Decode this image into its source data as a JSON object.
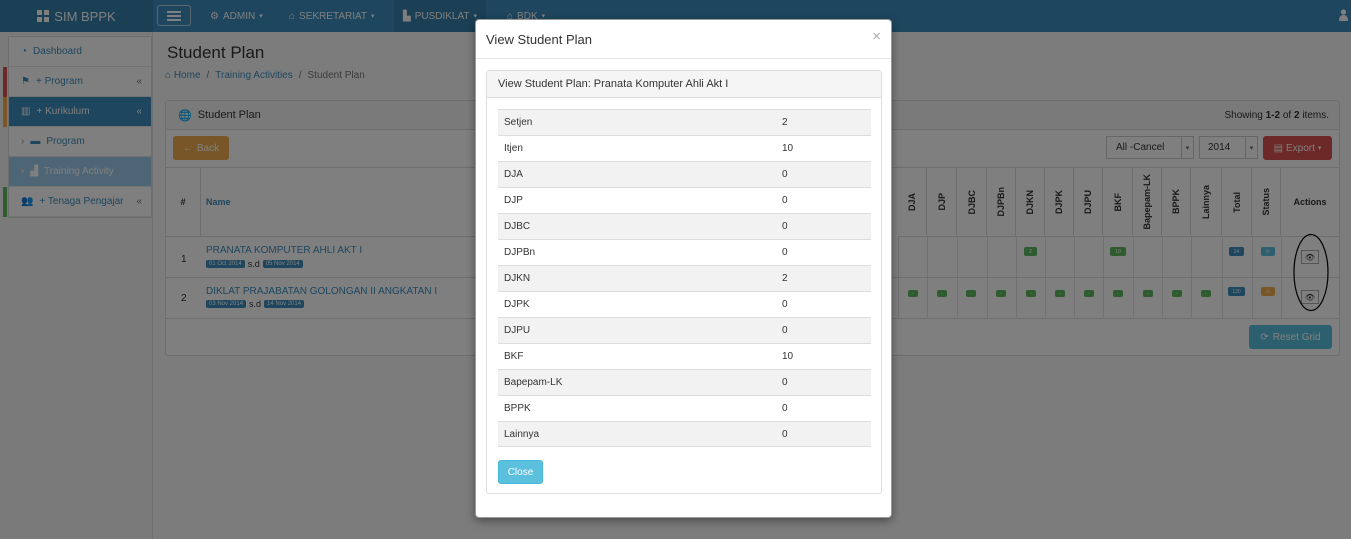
{
  "brand": "SIM BPPK",
  "topnav": [
    {
      "label": "ADMIN"
    },
    {
      "label": "SEKRETARIAT"
    },
    {
      "label": "PUSDIKLAT"
    },
    {
      "label": "BDK"
    }
  ],
  "sidebar": {
    "items": [
      {
        "label": "Dashboard"
      },
      {
        "label": "+ Program"
      },
      {
        "label": "+ Kurikulum"
      },
      {
        "label": "Program"
      },
      {
        "label": "Training Activity"
      },
      {
        "label": "+ Tenaga Pengajar"
      }
    ]
  },
  "page": {
    "title": "Student Plan",
    "breadcrumb": [
      "Home",
      "Training Activities",
      "Student Plan"
    ],
    "panel_title": "Student Plan",
    "showing_prefix": "Showing ",
    "showing_range": "1-2",
    "showing_mid": " of ",
    "showing_total": "2",
    "showing_suffix": " items.",
    "back_label": "Back",
    "cancel_filter": "All -Cancel",
    "year_filter": "2014",
    "export_label": "Export",
    "reset_label": "Reset Grid"
  },
  "grid": {
    "headers": {
      "num": "#",
      "name": "Name",
      "actions": "Actions"
    },
    "vheaders": [
      "DJA",
      "DJP",
      "DJBC",
      "DJPBn",
      "DJKN",
      "DJPK",
      "DJPU",
      "BKF",
      "Bapepam-LK",
      "BPPK",
      "Lainnya",
      "Total",
      "Status"
    ],
    "rows": [
      {
        "num": "1",
        "name": "PRANATA KOMPUTER AHLI AKT I",
        "start": "01 Oct 2014",
        "sd": "s.d",
        "end": "05 Nov 2014",
        "djkn": "2",
        "bkf": "10",
        "total": "24"
      },
      {
        "num": "2",
        "name": "DIKLAT PRAJABATAN GOLONGAN II ANGKATAN I",
        "start": "03 Nov 2014",
        "sd": "s.d",
        "end": "14 Nov 2014",
        "total": "120"
      }
    ]
  },
  "modal": {
    "title": "View Student Plan",
    "close_symbol": "×",
    "subtitle": "View Student Plan: Pranata Komputer Ahli Akt I",
    "rows": [
      {
        "label": "Setjen",
        "value": "2"
      },
      {
        "label": "Itjen",
        "value": "10"
      },
      {
        "label": "DJA",
        "value": "0"
      },
      {
        "label": "DJP",
        "value": "0"
      },
      {
        "label": "DJBC",
        "value": "0"
      },
      {
        "label": "DJPBn",
        "value": "0"
      },
      {
        "label": "DJKN",
        "value": "2"
      },
      {
        "label": "DJPK",
        "value": "0"
      },
      {
        "label": "DJPU",
        "value": "0"
      },
      {
        "label": "BKF",
        "value": "10"
      },
      {
        "label": "Bapepam-LK",
        "value": "0"
      },
      {
        "label": "BPPK",
        "value": "0"
      },
      {
        "label": "Lainnya",
        "value": "0"
      }
    ],
    "close_label": "Close"
  },
  "colors": {
    "primary": "#3c8dbc",
    "warning": "#f0ad4e",
    "danger": "#d9534f",
    "info": "#5bc0de",
    "success": "#5cb85c"
  }
}
